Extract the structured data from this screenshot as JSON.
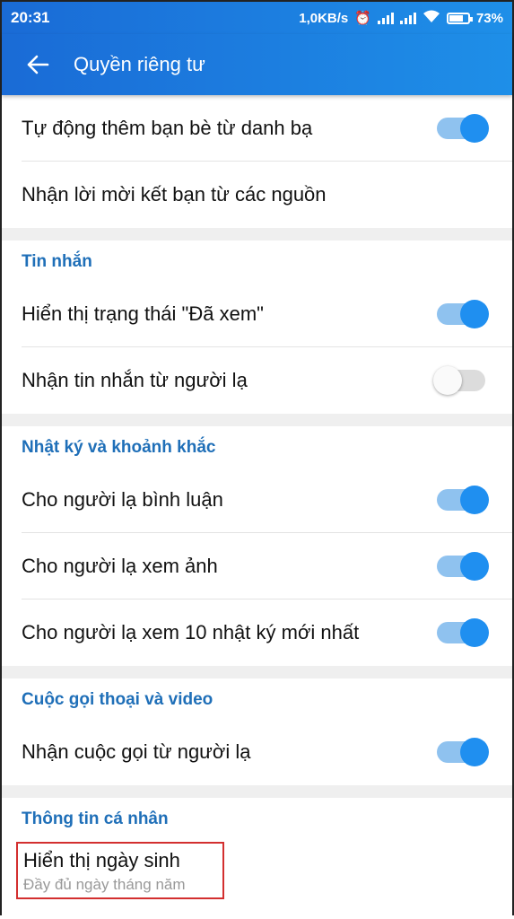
{
  "status_bar": {
    "time": "20:31",
    "speed": "1,0KB/s",
    "battery": "73%"
  },
  "app_bar": {
    "title": "Quyền riêng tư"
  },
  "friends": {
    "auto_add": "Tự động thêm bạn bè từ danh bạ",
    "auto_add_on": true,
    "receive_invites": "Nhận lời mời kết bạn từ các nguồn"
  },
  "messages": {
    "title": "Tin nhắn",
    "seen_status": "Hiển thị trạng thái \"Đã xem\"",
    "seen_on": true,
    "from_strangers": "Nhận tin nhắn từ người lạ",
    "from_strangers_on": false
  },
  "diary": {
    "title": "Nhật ký và khoảnh khắc",
    "comment": "Cho người lạ bình luận",
    "view_photos": "Cho người lạ xem ảnh",
    "view_10": "Cho người lạ xem 10 nhật ký mới nhất"
  },
  "calls": {
    "title": "Cuộc gọi thoại và video",
    "from_strangers": "Nhận cuộc gọi từ người lạ"
  },
  "personal": {
    "title": "Thông tin cá nhân",
    "birthday": "Hiển thị ngày sinh",
    "birthday_value": "Đầy đủ ngày tháng năm"
  },
  "colors": {
    "accent": "#1f8ff0",
    "header": "#1a6bd6",
    "section": "#1f6fb8",
    "highlight": "#d32f2f"
  }
}
